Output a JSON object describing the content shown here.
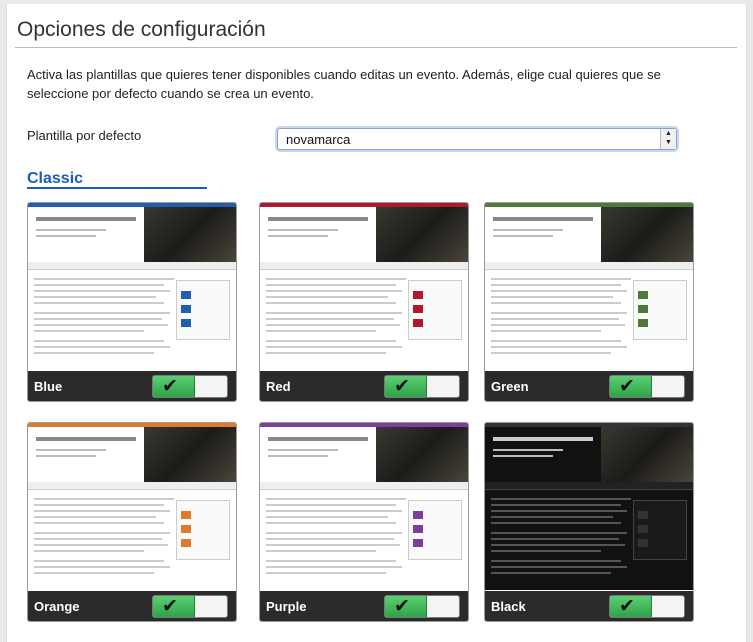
{
  "page": {
    "title": "Opciones de configuración",
    "description": "Activa las plantillas que quieres tener disponibles cuando editas un evento. Además, elige cual quieres que se seleccione por defecto cuando se crea un evento.",
    "default_label": "Plantilla por defecto",
    "default_value": "novamarca",
    "section_title": "Classic"
  },
  "templates": [
    {
      "name": "Blue",
      "accent": "#1f5fb0",
      "enabled": true
    },
    {
      "name": "Red",
      "accent": "#b0182e",
      "enabled": true
    },
    {
      "name": "Green",
      "accent": "#4f7a3c",
      "enabled": true
    },
    {
      "name": "Orange",
      "accent": "#e07a2a",
      "enabled": true
    },
    {
      "name": "Purple",
      "accent": "#7a3f9d",
      "enabled": true
    },
    {
      "name": "Black",
      "accent": "#333333",
      "enabled": true
    }
  ],
  "icons": {
    "toggle_check": "✔",
    "select_arrows": "select-arrows-icon"
  }
}
